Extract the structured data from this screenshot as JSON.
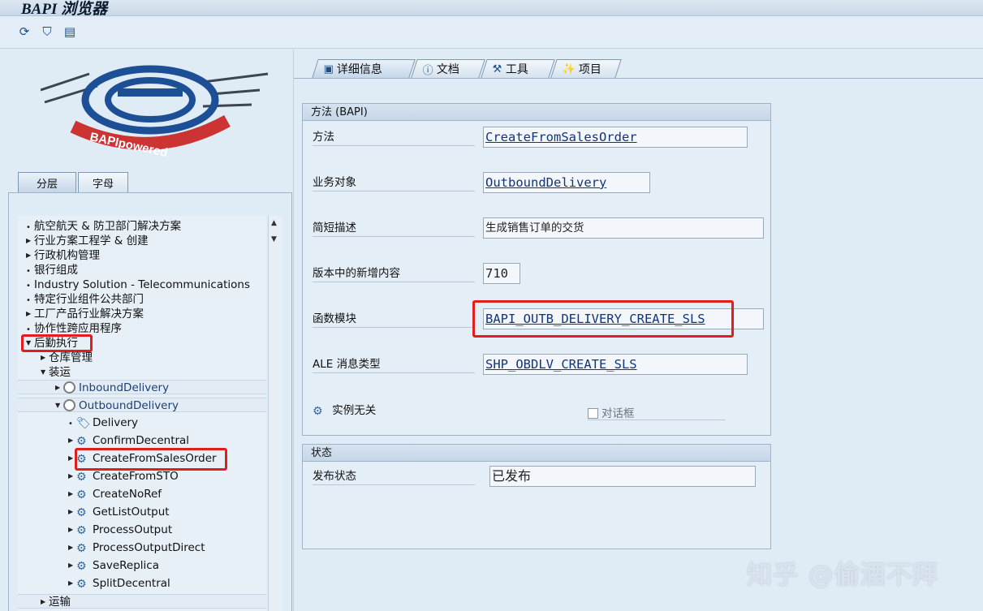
{
  "window": {
    "title": "BAPI 浏览器"
  },
  "toolbar": {
    "icons": [
      "refresh-icon",
      "filter-icon",
      "list-icon"
    ]
  },
  "left": {
    "logo_text": "BAPIpowered",
    "tabs": [
      "分层",
      "字母"
    ],
    "tree": [
      {
        "label": "航空航天 & 防卫部门解决方案",
        "kind": "bullet"
      },
      {
        "label": "行业方案工程学 & 创建",
        "kind": "collapsed"
      },
      {
        "label": "行政机构管理",
        "kind": "collapsed"
      },
      {
        "label": "银行组成",
        "kind": "bullet"
      },
      {
        "label": "Industry Solution - Telecommunications",
        "kind": "bullet"
      },
      {
        "label": "特定行业组件公共部门",
        "kind": "bullet"
      },
      {
        "label": "工厂产品行业解决方案",
        "kind": "collapsed"
      },
      {
        "label": "协作性跨应用程序",
        "kind": "bullet"
      },
      {
        "label": "后勤执行",
        "kind": "expanded"
      },
      {
        "label": "仓库管理",
        "kind": "collapsed"
      },
      {
        "label": "装运",
        "kind": "expanded"
      },
      {
        "label": "InboundDelivery",
        "kind": "collapsed"
      },
      {
        "label": "OutboundDelivery",
        "kind": "expanded"
      },
      {
        "label": "Delivery",
        "kind": "bullet"
      },
      {
        "label": "ConfirmDecentral",
        "kind": "collapsed"
      },
      {
        "label": "CreateFromSalesOrder",
        "kind": "collapsed"
      },
      {
        "label": "CreateFromSTO",
        "kind": "collapsed"
      },
      {
        "label": "CreateNoRef",
        "kind": "collapsed"
      },
      {
        "label": "GetListOutput",
        "kind": "collapsed"
      },
      {
        "label": "ProcessOutput",
        "kind": "collapsed"
      },
      {
        "label": "ProcessOutputDirect",
        "kind": "collapsed"
      },
      {
        "label": "SaveReplica",
        "kind": "collapsed"
      },
      {
        "label": "SplitDecentral",
        "kind": "collapsed"
      },
      {
        "label": "运输",
        "kind": "collapsed"
      }
    ]
  },
  "right": {
    "tabs": [
      "详细信息",
      "文档",
      "工具",
      "项目"
    ],
    "method_group": {
      "title": "方法 (BAPI)",
      "fields": [
        {
          "label": "方法",
          "value": "CreateFromSalesOrder"
        },
        {
          "label": "业务对象",
          "value": "OutboundDelivery"
        },
        {
          "label": "简短描述",
          "value": "生成销售订单的交货"
        },
        {
          "label": "版本中的新增内容",
          "value": "710"
        },
        {
          "label": "函数模块",
          "value": "BAPI_OUTB_DELIVERY_CREATE_SLS"
        },
        {
          "label": "ALE 消息类型",
          "value": "SHP_OBDLV_CREATE_SLS"
        }
      ],
      "instance_label": "实例无关",
      "dialog_checkbox": "对话框"
    },
    "status_group": {
      "title": "状态",
      "label": "发布状态",
      "value": "已发布"
    }
  },
  "watermark": "知乎 @偷酒不拜"
}
